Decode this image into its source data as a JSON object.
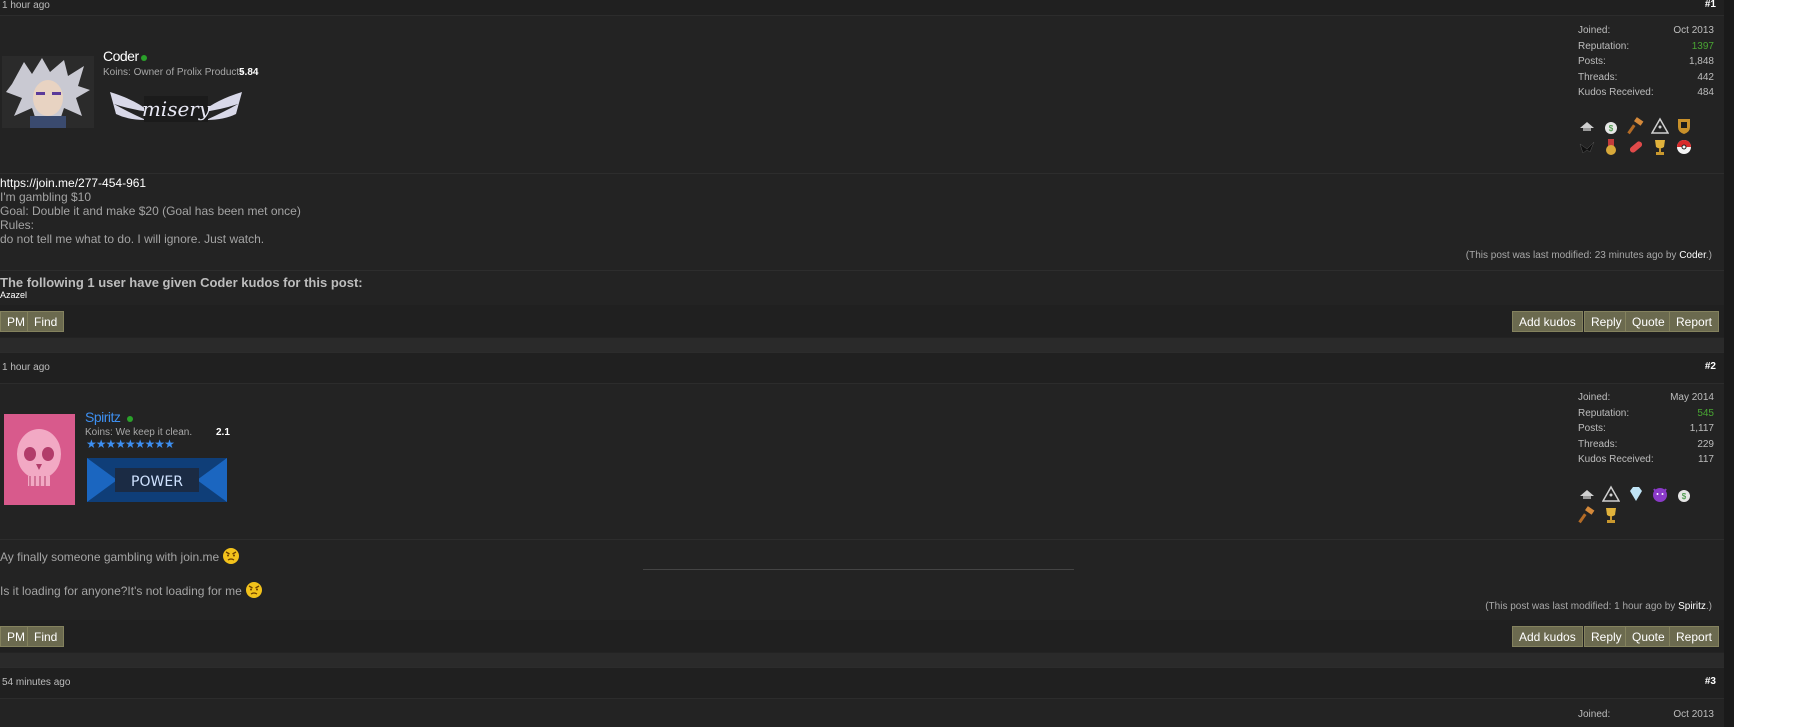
{
  "posts": [
    {
      "timestamp": "1 hour ago",
      "number": "#1",
      "author": {
        "name": "Coder",
        "koins_label": "Koins: Owner of Prolix Products",
        "koins_value": "5.84",
        "banner_text": "misery"
      },
      "stats": {
        "joined_label": "Joined:",
        "joined": "Oct 2013",
        "reputation_label": "Reputation:",
        "reputation": "1397",
        "posts_label": "Posts:",
        "posts": "1,848",
        "threads_label": "Threads:",
        "threads": "442",
        "kudos_label": "Kudos Received:",
        "kudos": "484"
      },
      "body": {
        "line1": "https://join.me/277-454-961",
        "line2": "I'm gambling $10",
        "line3": "Goal: Double it and make $20 (Goal has been met once)",
        "line4": "Rules:",
        "line5": "do not tell me what to do. I will ignore. Just watch."
      },
      "modified_prefix": "(This post was last modified: 23 minutes ago by",
      "modified_by": "Coder",
      "modified_suffix": ".)",
      "kudos_title": "The following 1 user have given Coder kudos for this post:",
      "kudos_users": "Azazel"
    },
    {
      "timestamp": "1 hour ago",
      "number": "#2",
      "author": {
        "name": "Spiritz",
        "koins_label": "Koins: We keep it clean.",
        "koins_value": "2.1",
        "banner_text": "POWER",
        "stars": "★★★★★★★★★"
      },
      "stats": {
        "joined_label": "Joined:",
        "joined": "May 2014",
        "reputation_label": "Reputation:",
        "reputation": "545",
        "posts_label": "Posts:",
        "posts": "1,117",
        "threads_label": "Threads:",
        "threads": "229",
        "kudos_label": "Kudos Received:",
        "kudos": "117"
      },
      "body": {
        "line1": "Ay finally someone gambling with join.me",
        "line2": "Is it loading for anyone?It's not loading for me"
      },
      "modified_prefix": "(This post was last modified: 1 hour ago by",
      "modified_by": "Spiritz",
      "modified_suffix": ".)"
    },
    {
      "timestamp": "54 minutes ago",
      "number": "#3",
      "stats": {
        "joined_label": "Joined:",
        "joined": "Oct 2013"
      }
    }
  ],
  "buttons": {
    "pm": "PM",
    "find": "Find",
    "add_kudos": "Add kudos",
    "reply": "Reply",
    "quote": "Quote",
    "report": "Report"
  },
  "colors": {
    "button_bg": "#6b6a4f",
    "reputation_green": "#49a633",
    "spiritz_name": "#3d8ff0",
    "online": "#2aa12a"
  },
  "icons": {
    "award_icons_post1": [
      "hat-icon",
      "money-bag-icon",
      "gavel-icon",
      "pyramid-icon",
      "crest-icon",
      "dark-bird-icon",
      "medal-icon",
      "pill-icon",
      "trophy-icon",
      "pokeball-icon"
    ],
    "award_icons_post2": [
      "hat-icon",
      "pyramid-icon",
      "diamond-icon",
      "devil-icon",
      "money-bag-icon",
      "gavel-icon",
      "trophy-icon"
    ],
    "emoji_post2": [
      "angry-smiley-icon",
      "angry-smiley-icon"
    ]
  }
}
